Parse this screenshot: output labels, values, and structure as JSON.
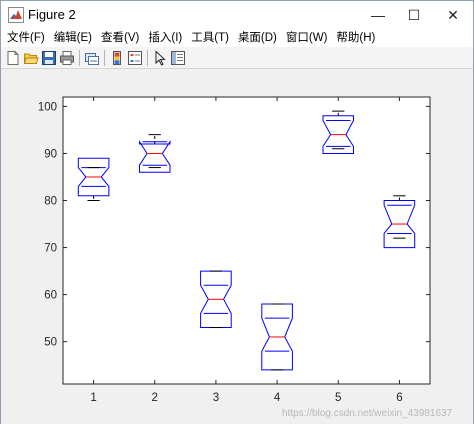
{
  "window": {
    "title": "Figure 2",
    "controls": {
      "minimize": "—",
      "maximize": "☐",
      "close": "✕"
    }
  },
  "menu": [
    {
      "label": "文件(F)"
    },
    {
      "label": "编辑(E)"
    },
    {
      "label": "查看(V)"
    },
    {
      "label": "插入(I)"
    },
    {
      "label": "工具(T)"
    },
    {
      "label": "桌面(D)"
    },
    {
      "label": "窗口(W)"
    },
    {
      "label": "帮助(H)"
    }
  ],
  "toolbar": {
    "icons": [
      "new-figure-icon",
      "open-file-icon",
      "save-icon",
      "print-icon",
      "link-icon",
      "insert-colorbar-icon",
      "insert-legend-icon",
      "pointer-icon",
      "property-inspector-icon"
    ]
  },
  "watermark": "https://blog.csdn.net/weixin_43981637",
  "colors": {
    "box": "#0000ff",
    "median": "#ff0000",
    "whisker": "#000000",
    "axes": "#262626"
  },
  "chart_data": {
    "type": "box",
    "notched": true,
    "categories": [
      "1",
      "2",
      "3",
      "4",
      "5",
      "6"
    ],
    "xlim": [
      0.5,
      6.5
    ],
    "ylim": [
      41,
      102
    ],
    "yticks": [
      50,
      60,
      70,
      80,
      90,
      100
    ],
    "yticklabels": [
      "50",
      "60",
      "70",
      "80",
      "90",
      "100"
    ],
    "boxes": [
      {
        "label": "1",
        "q1": 81,
        "median": 85,
        "q3": 89,
        "notch_low": 83,
        "notch_high": 87,
        "whisker_low": 80,
        "whisker_high": 87
      },
      {
        "label": "2",
        "q1": 86,
        "median": 90,
        "q3": 92,
        "notch_low": 87.5,
        "notch_high": 92.5,
        "whisker_low": 87,
        "whisker_high": 94
      },
      {
        "label": "3",
        "q1": 53,
        "median": 59,
        "q3": 65,
        "notch_low": 56,
        "notch_high": 62,
        "whisker_low": 53,
        "whisker_high": 65
      },
      {
        "label": "4",
        "q1": 44,
        "median": 51,
        "q3": 58,
        "notch_low": 48,
        "notch_high": 55,
        "whisker_low": 44,
        "whisker_high": 58
      },
      {
        "label": "5",
        "q1": 90,
        "median": 94,
        "q3": 98,
        "notch_low": 91.5,
        "notch_high": 97,
        "whisker_low": 91,
        "whisker_high": 99
      },
      {
        "label": "6",
        "q1": 70,
        "median": 75,
        "q3": 80,
        "notch_low": 73,
        "notch_high": 79,
        "whisker_low": 72,
        "whisker_high": 81
      }
    ]
  }
}
